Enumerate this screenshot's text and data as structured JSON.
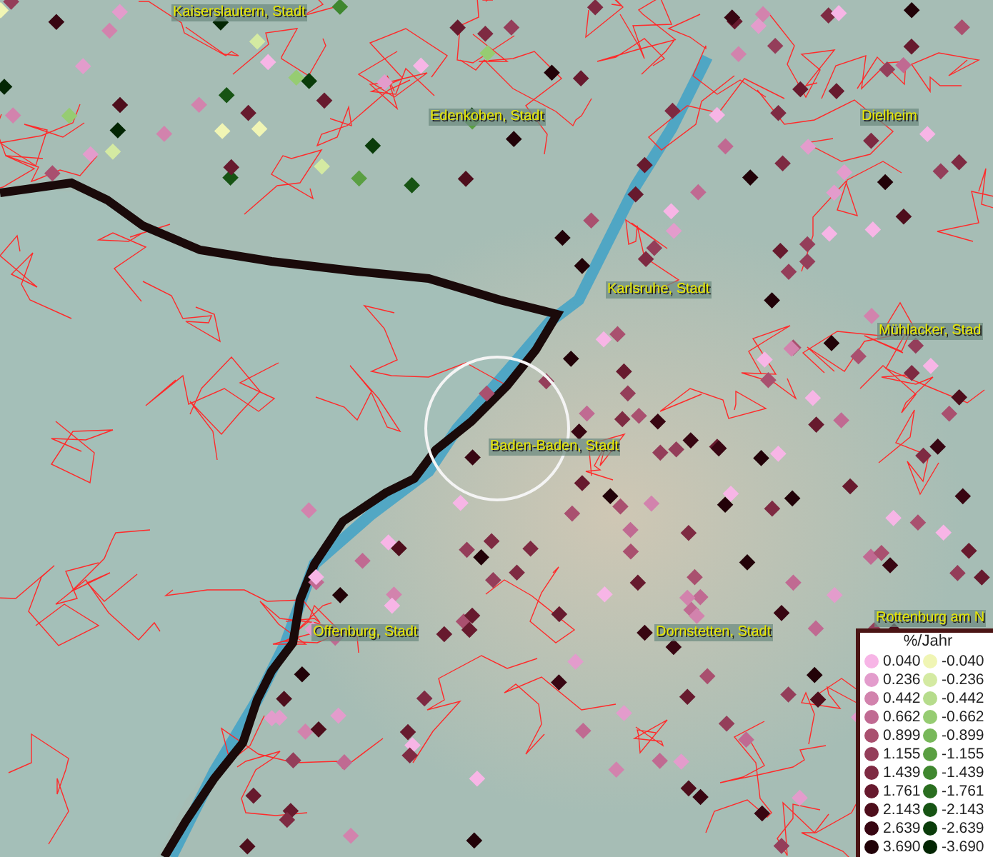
{
  "map": {
    "place_labels": [
      {
        "text": "Kaiserslautern, Stadt"
      },
      {
        "text": "Edenkoben, Stadt"
      },
      {
        "text": "Dielheim"
      },
      {
        "text": "Karlsruhe, Stadt"
      },
      {
        "text": "Mühlacker, Stad"
      },
      {
        "text": "Baden-Baden, Stadt"
      },
      {
        "text": "Offenburg, Stadt"
      },
      {
        "text": "Dornstetten, Stadt"
      },
      {
        "text": "Rottenburg am N"
      }
    ]
  },
  "legend": {
    "title": "%/Jahr",
    "rows": [
      {
        "positive": {
          "value": "0.040",
          "color": "#f7b5e6"
        },
        "negative": {
          "value": "-0.040",
          "color": "#f0f5b4"
        }
      },
      {
        "positive": {
          "value": "0.236",
          "color": "#e39ccc"
        },
        "negative": {
          "value": "-0.236",
          "color": "#d4eaa2"
        }
      },
      {
        "positive": {
          "value": "0.442",
          "color": "#d283ad"
        },
        "negative": {
          "value": "-0.442",
          "color": "#b6dc8c"
        }
      },
      {
        "positive": {
          "value": "0.662",
          "color": "#c06a92"
        },
        "negative": {
          "value": "-0.662",
          "color": "#96cc72"
        }
      },
      {
        "positive": {
          "value": "0.899",
          "color": "#a9506f"
        },
        "negative": {
          "value": "-0.899",
          "color": "#78b85a"
        }
      },
      {
        "positive": {
          "value": "1.155",
          "color": "#943e5a"
        },
        "negative": {
          "value": "-1.155",
          "color": "#5a9f42"
        }
      },
      {
        "positive": {
          "value": "1.439",
          "color": "#7e2a42"
        },
        "negative": {
          "value": "-1.439",
          "color": "#3f872f"
        }
      },
      {
        "positive": {
          "value": "1.761",
          "color": "#671a2e"
        },
        "negative": {
          "value": "-1.761",
          "color": "#2a6e20"
        }
      },
      {
        "positive": {
          "value": "2.143",
          "color": "#4e0e1c"
        },
        "negative": {
          "value": "-2.143",
          "color": "#175414"
        }
      },
      {
        "positive": {
          "value": "2.639",
          "color": "#380612"
        },
        "negative": {
          "value": "-2.639",
          "color": "#0a3c0a"
        }
      },
      {
        "positive": {
          "value": "3.690",
          "color": "#220208"
        },
        "negative": {
          "value": "-3.690",
          "color": "#032603"
        }
      }
    ]
  }
}
